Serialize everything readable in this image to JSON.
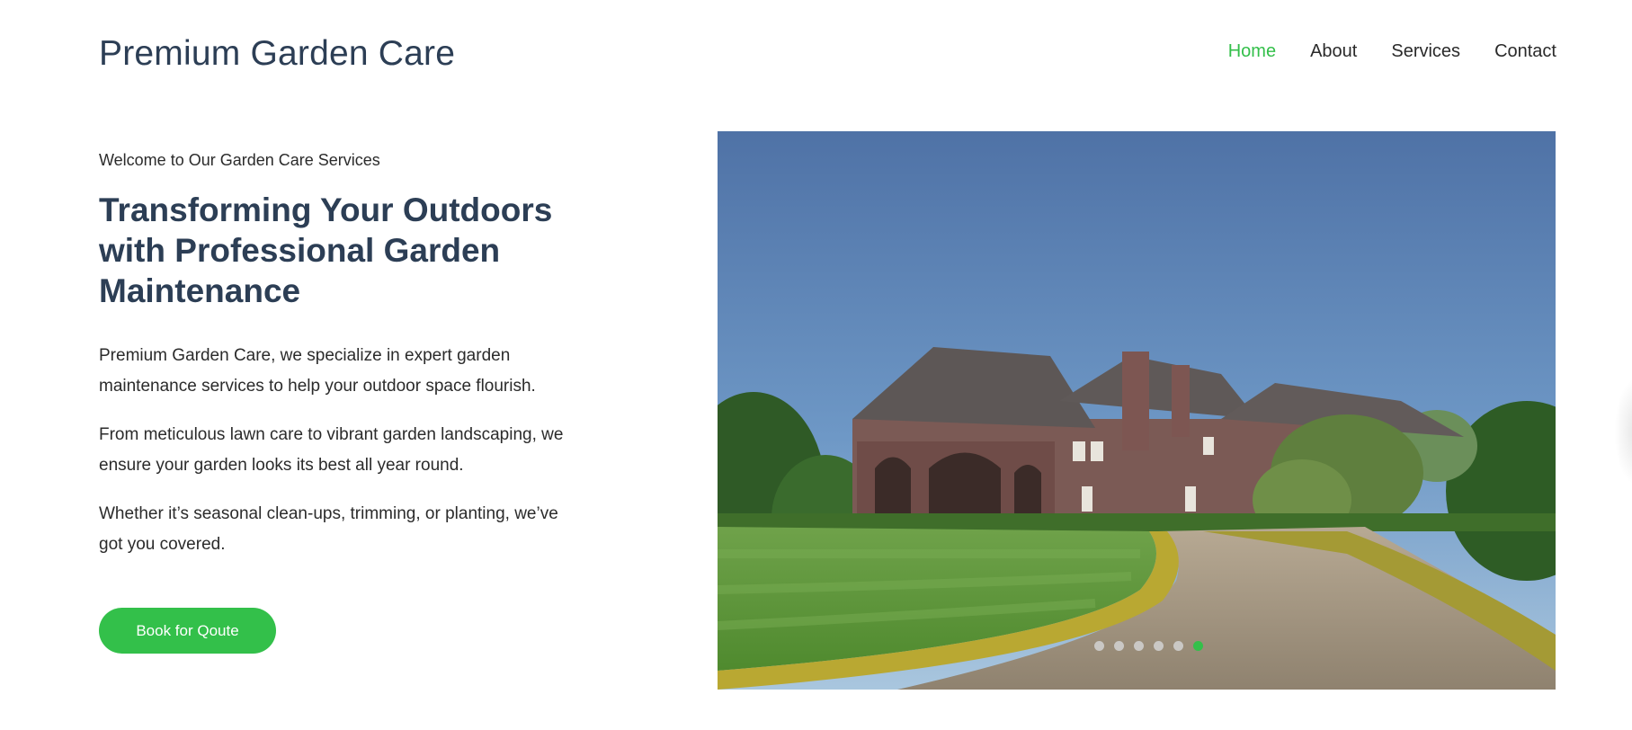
{
  "header": {
    "logo": "Premium Garden Care",
    "nav": [
      {
        "label": "Home",
        "active": true
      },
      {
        "label": "About",
        "active": false
      },
      {
        "label": "Services",
        "active": false
      },
      {
        "label": "Contact",
        "active": false
      }
    ]
  },
  "hero": {
    "eyebrow": "Welcome to Our Garden Care Services",
    "headline": "Transforming Your Outdoors with Professional Garden Maintenance",
    "paragraphs": [
      "Premium Garden Care, we specialize in expert garden maintenance services to help your outdoor space flourish.",
      "From meticulous lawn care to vibrant garden landscaping, we ensure your garden looks its best all year round.",
      "Whether it’s seasonal clean-ups, trimming, or planting, we’ve got you covered."
    ],
    "cta_label": "Book for Qoute"
  },
  "slider": {
    "image_subject": "estate-house-with-lawn-photo",
    "slide_count": 6,
    "active_slide": 6
  },
  "colors": {
    "accent": "#33c04a",
    "heading": "#2c3e55",
    "text": "#2b2b2b"
  }
}
